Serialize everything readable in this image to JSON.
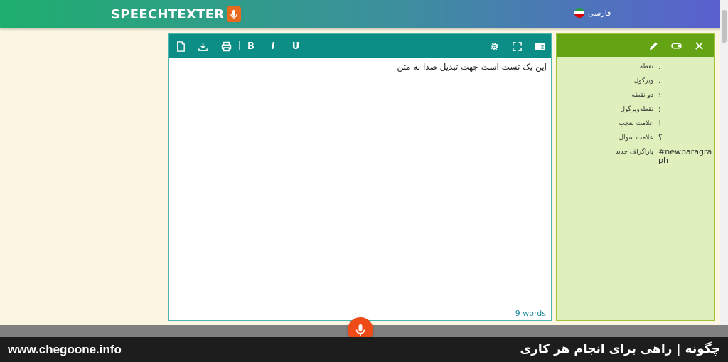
{
  "header": {
    "logo_text": "SPEECHTEXTER",
    "language_label": "فارسی"
  },
  "editor": {
    "toolbar": {
      "bold_label": "B",
      "italic_label": "I",
      "underline_label": "U"
    },
    "text": "این یک تست است جهت تبدیل صدا به متن",
    "word_count": "9 words"
  },
  "punctuation_panel": {
    "items": [
      {
        "name": "نقطه",
        "symbol": "."
      },
      {
        "name": "ویرگول",
        "symbol": "،"
      },
      {
        "name": "دو نقطه",
        "symbol": ":"
      },
      {
        "name": "نقطه‌ویرگول",
        "symbol": "؛"
      },
      {
        "name": "علامت تعجب",
        "symbol": "!"
      },
      {
        "name": "علامت سوال",
        "symbol": "؟"
      },
      {
        "name": "پاراگراف جدید",
        "symbol": "#newparagraph"
      }
    ]
  },
  "watermark": {
    "left": "www.chegoone.info",
    "right": "چگونه | راهی برای انجام هر کاری"
  },
  "colors": {
    "editor_toolbar": "#0c8d86",
    "panel_toolbar": "#64a314",
    "mic_button": "#f04a17",
    "logo_mic": "#e86a1e"
  }
}
